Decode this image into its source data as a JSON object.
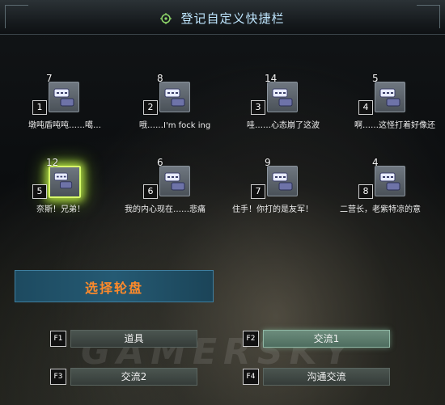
{
  "header": {
    "title": "登记自定义快捷栏"
  },
  "slots": [
    {
      "count": "7",
      "key": "1",
      "text": "墩吨盾吨吨……噶…"
    },
    {
      "count": "8",
      "key": "2",
      "text": "哦……I'm  fock ing"
    },
    {
      "count": "14",
      "key": "3",
      "text": "哇……心态崩了这波"
    },
    {
      "count": "5",
      "key": "4",
      "text": "啊……这怪打着好像还"
    },
    {
      "count": "12",
      "key": "5",
      "text": "奈斯！兄弟！"
    },
    {
      "count": "6",
      "key": "6",
      "text": "我的内心现在……悲痛"
    },
    {
      "count": "9",
      "key": "7",
      "text": "住手！你打的是友军！"
    },
    {
      "count": "4",
      "key": "8",
      "text": "二营长，老紫特凉的意"
    }
  ],
  "wheel": {
    "label": "选择轮盘"
  },
  "fkeys": [
    {
      "key": "F1",
      "label": "道具"
    },
    {
      "key": "F2",
      "label": "交流1"
    },
    {
      "key": "F3",
      "label": "交流2"
    },
    {
      "key": "F4",
      "label": "沟通交流"
    }
  ],
  "watermark": "GAMERSKY",
  "colors": {
    "title": "#bfe6ff",
    "wheel_label": "#ff8a2a",
    "selected_glow": "#d9ff6a",
    "wheel_bar": "#255a73"
  },
  "icons": {
    "slot_icon": "chat-bubble-icon",
    "title_icon": "target-icon"
  }
}
